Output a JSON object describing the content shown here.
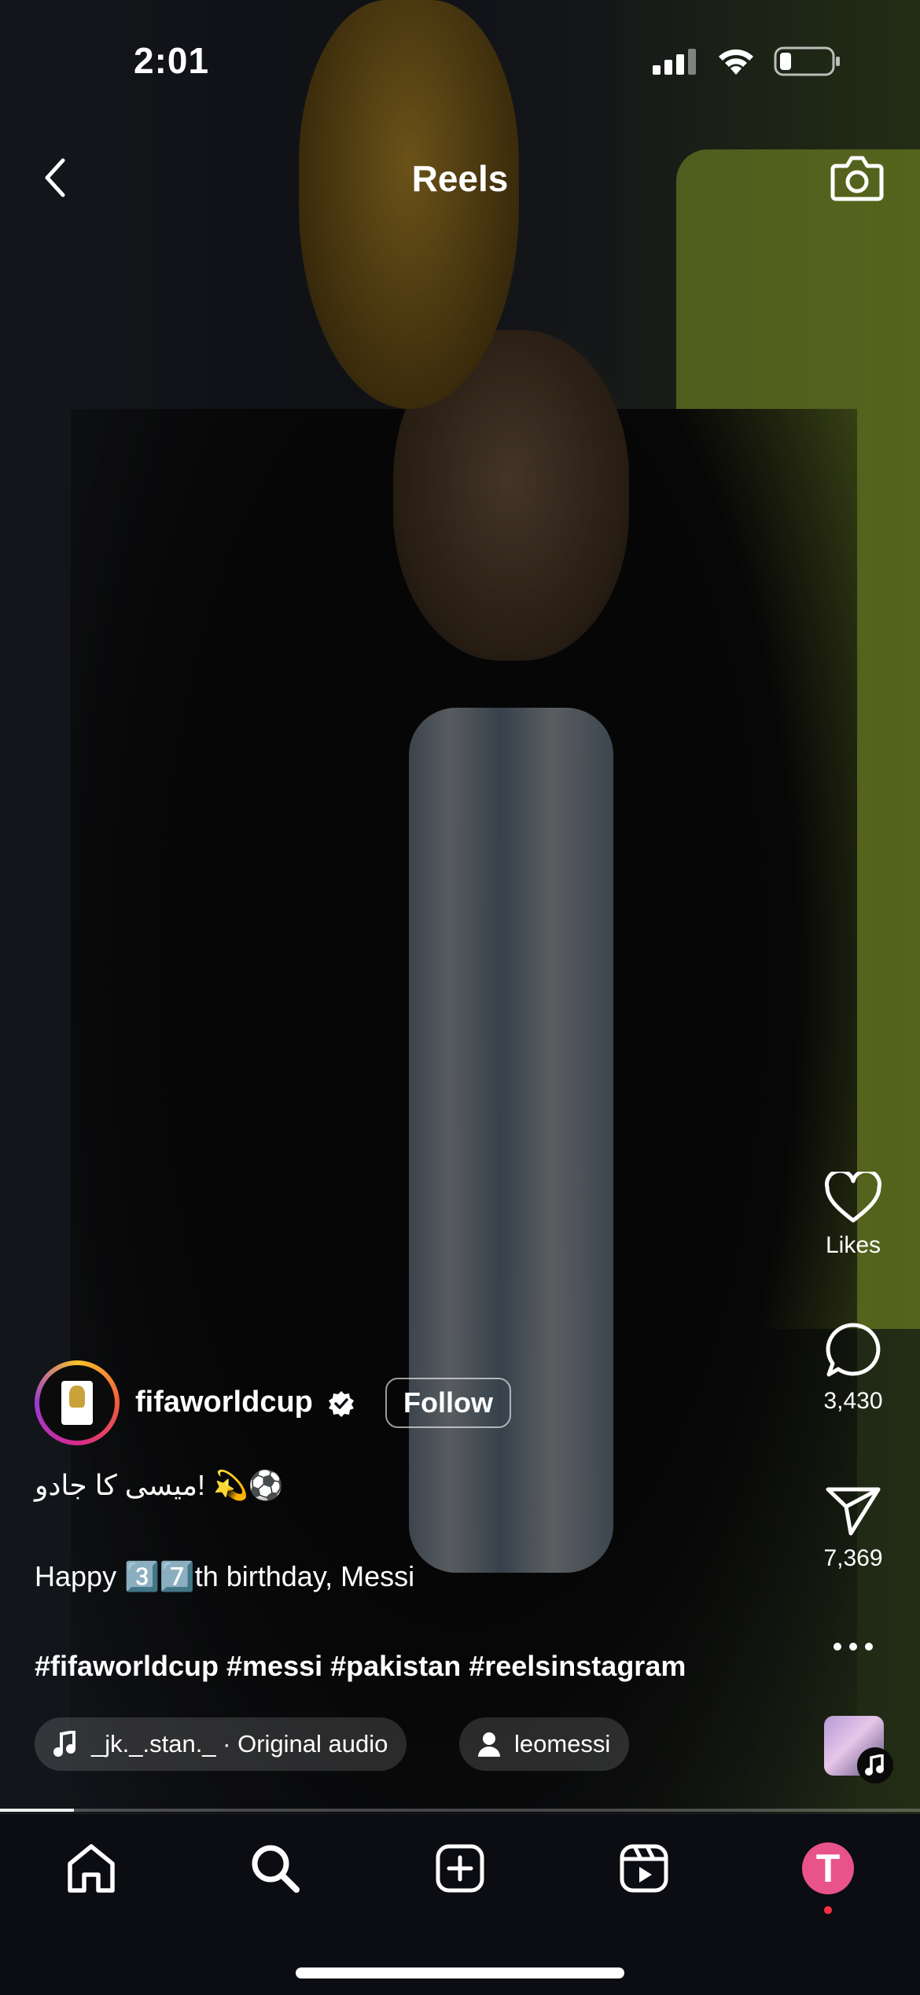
{
  "status_bar": {
    "time": "2:01"
  },
  "header": {
    "title": "Reels"
  },
  "actions": {
    "likes_label": "Likes",
    "comments_count": "3,430",
    "shares_count": "7,369"
  },
  "post": {
    "username": "fifaworldcup",
    "follow_label": "Follow",
    "caption_line1": "میسی کا جادو! 💫⚽",
    "caption_line2": "Happy 3️⃣7️⃣th birthday, Messi",
    "hashtags": "#fifaworldcup #messi #pakistan #reelsinstagram",
    "audio": "_jk._.stan._ · Original audio",
    "tagged_user": "leomessi"
  },
  "playback": {
    "progress": 0.08
  },
  "nav": {
    "items": [
      "home-icon",
      "search-icon",
      "create-icon",
      "reels-icon",
      "profile-avatar"
    ],
    "profile_initial": "T"
  },
  "colors": {
    "profile": "#e8538a",
    "notification_dot": "#ff3040"
  }
}
